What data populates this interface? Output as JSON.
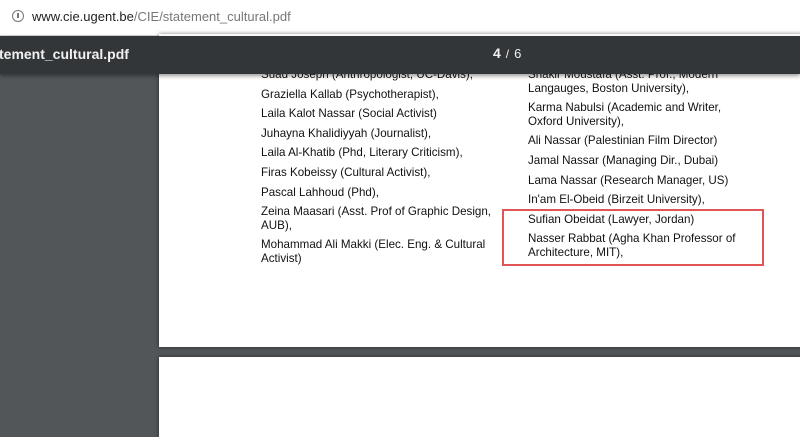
{
  "browser": {
    "url_host": "www.cie.ugent.be",
    "url_path": "/CIE/statement_cultural.pdf"
  },
  "viewer": {
    "doc_title": "tement_cultural.pdf",
    "current_page": "4",
    "separator": "/",
    "total_pages": "6"
  },
  "document": {
    "left_column": [
      "Suad Joseph (Anthropologist, UC-Davis),",
      "Graziella Kallab (Psychotherapist),",
      "Laila Kalot Nassar (Social Activist)",
      "Juhayna Khalidiyyah (Journalist),",
      "Laila Al-Khatib (Phd, Literary Criticism),",
      "Firas Kobeissy (Cultural Activist),",
      "Pascal Lahhoud (Phd),",
      "Zeina Maasari (Asst. Prof of Graphic Design, AUB),",
      "Mohammad Ali Makki (Elec. Eng. & Cultural Activist)"
    ],
    "right_column": [
      "Shakir Moustafa (Asst. Prof., Modern Langauges, Boston University),",
      "Karma Nabulsi (Academic and Writer, Oxford University),",
      "Ali Nassar  (Palestinian Film Director)",
      "Jamal Nassar (Managing Dir., Dubai)",
      "Lama Nassar (Research Manager, US)",
      "In'am El-Obeid (Birzeit University),",
      "Sufian Obeidat (Lawyer, Jordan)",
      "Nasser Rabbat (Agha Khan Professor of Architecture, MIT),"
    ]
  },
  "annotation": {
    "highlight_color": "#e05555"
  }
}
